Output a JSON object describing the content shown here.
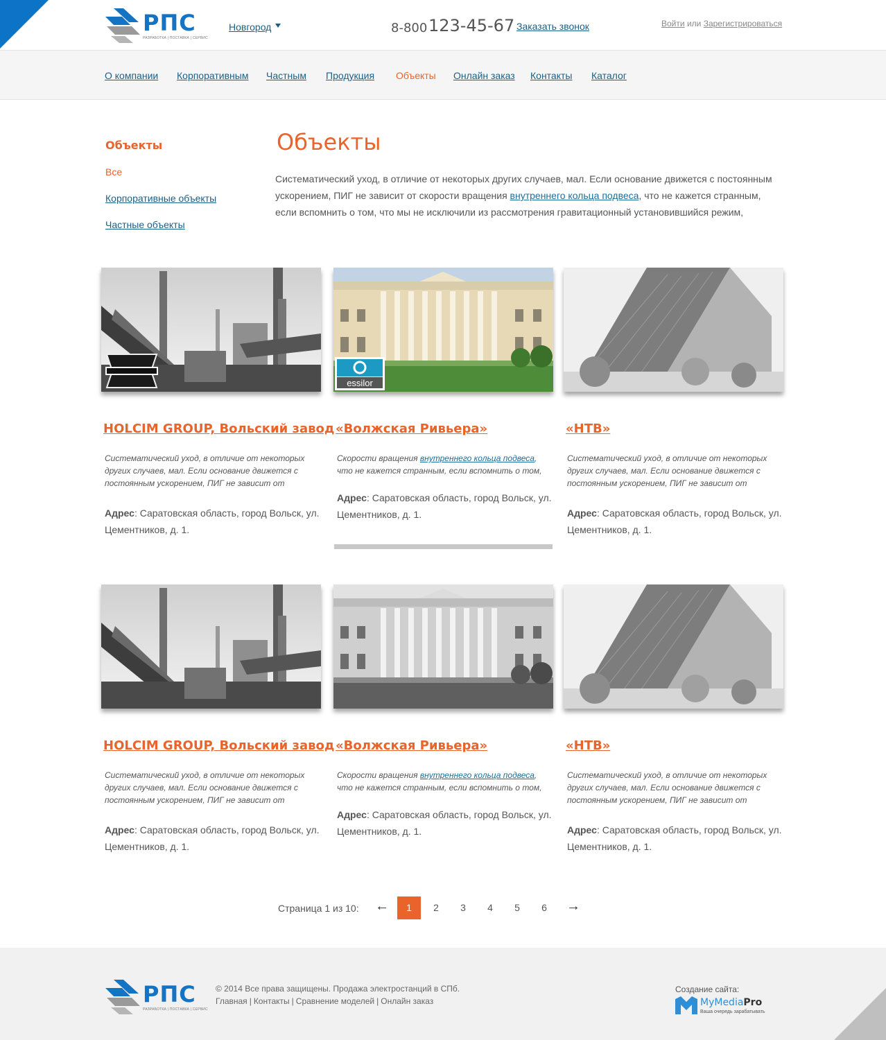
{
  "header": {
    "logo_text": "РПС",
    "logo_sub": "РАЗРАБОТКА | ПОСТАВКА | СЕРВИС",
    "city": "Новгород",
    "phone_prefix": "8-800",
    "phone_number": "123-45-67",
    "callback": "Заказать звонок",
    "login": "Войти",
    "or": "или",
    "register": "Зарегистрироваться"
  },
  "nav": [
    {
      "label": "О компании"
    },
    {
      "label": "Корпоративным"
    },
    {
      "label": "Частным"
    },
    {
      "label": "Продукция"
    },
    {
      "label": "Объекты",
      "active": true
    },
    {
      "label": "Онлайн заказ"
    },
    {
      "label": "Контакты"
    },
    {
      "label": "Каталог"
    }
  ],
  "sidebar": {
    "title": "Объекты",
    "items": [
      {
        "label": "Все",
        "active": true
      },
      {
        "label": "Корпоративные объекты"
      },
      {
        "label": "Частные объекты"
      }
    ]
  },
  "main": {
    "title": "Объекты",
    "intro_1": "Систематический уход, в отличие от некоторых других случаев, мал. Если основание движется с постоянным ускорением, ПИГ не зависит от скорости вращения ",
    "intro_link": "внутреннего кольца подвеса",
    "intro_2": ", что не кажется странным, если вспомнить о том, что мы не исключили из рассмотрения гравитационный установившийся режим,"
  },
  "cards": [
    {
      "title": "HOLCIM GROUP, Вольский завод",
      "desc": "Систематический уход, в отличие от некоторых других случаев, мал. Если основание движется с постоянным ускорением, ПИГ не зависит от",
      "addr_label": "Адрес",
      "addr": ": Саратовская область, город Вольск, ул. Цементников, д. 1.",
      "badge": "HARLEY-DAVIDSON"
    },
    {
      "title": "«Волжская Ривьера»",
      "desc_pre": "Скорости вращения ",
      "desc_link": "внутреннего кольца подвеса",
      "desc_post": ", что не кажется странным, если вспомнить о том,",
      "addr_label": "Адрес",
      "addr": ": Саратовская область, город Вольск, ул. Цементников, д. 1.",
      "badge": "ESSILOR"
    },
    {
      "title": "«НТВ»",
      "desc": "Систематический уход, в отличие от некоторых других случаев, мал. Если основание движется с постоянным ускорением, ПИГ не зависит от",
      "addr_label": "Адрес",
      "addr": ": Саратовская область, город Вольск, ул. Цементников, д. 1."
    },
    {
      "title": "HOLCIM GROUP, Вольский завод",
      "desc": "Систематический уход, в отличие от некоторых других случаев, мал. Если основание движется с постоянным ускорением, ПИГ не зависит от",
      "addr_label": "Адрес",
      "addr": ": Саратовская область, город Вольск, ул. Цементников, д. 1."
    },
    {
      "title": "«Волжская Ривьера»",
      "desc_pre": "Скорости вращения ",
      "desc_link": "внутреннего кольца подвеса",
      "desc_post": ", что не кажется странным, если вспомнить о том,",
      "addr_label": "Адрес",
      "addr": ": Саратовская область, город Вольск, ул. Цементников, д. 1."
    },
    {
      "title": "«НТВ»",
      "desc": "Систематический уход, в отличие от некоторых других случаев, мал. Если основание движется с постоянным ускорением, ПИГ не зависит от",
      "addr_label": "Адрес",
      "addr": ": Саратовская область, город Вольск, ул. Цементников, д. 1."
    }
  ],
  "pagination": {
    "label": "Страница 1 из 10:",
    "prev": "←",
    "next": "→",
    "pages": [
      "1",
      "2",
      "3",
      "4",
      "5",
      "6"
    ],
    "current": "1"
  },
  "footer": {
    "copyright": "© 2014 Все права защищены. Продажа электростанций в СПб.",
    "links": [
      "Главная",
      "Контакты",
      "Сравнение моделей",
      "Онлайн заказ"
    ],
    "made_by": "Создание сайта:",
    "studio_a": "MyMedia",
    "studio_b": "Pro",
    "studio_slogan": "Ваша очередь зарабатывать"
  },
  "colors": {
    "accent": "#e8642a",
    "brand_blue": "#1473c3",
    "link": "#1a5f86"
  }
}
